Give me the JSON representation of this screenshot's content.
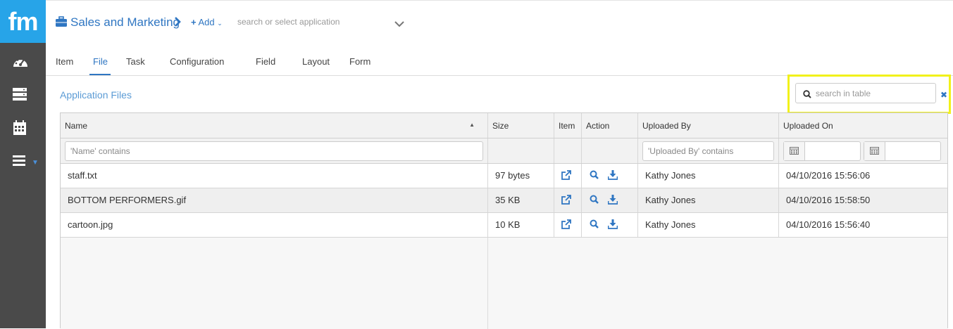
{
  "brand": {
    "logo_text": "fm",
    "color": "#27a4e8"
  },
  "sidebar": {
    "items": [
      {
        "icon": "dashboard-icon"
      },
      {
        "icon": "server-icon"
      },
      {
        "icon": "calendar-icon"
      },
      {
        "icon": "menu-icon"
      }
    ]
  },
  "topbar": {
    "app_name": "Sales and Marketing",
    "add_label": "Add",
    "app_search_placeholder": "search or select application"
  },
  "tabs": [
    {
      "label": "Item"
    },
    {
      "label": "File",
      "active": true
    },
    {
      "label": "Task"
    },
    {
      "label": "Configuration"
    },
    {
      "label": "Field"
    },
    {
      "label": "Layout"
    },
    {
      "label": "Form"
    }
  ],
  "panel": {
    "title": "Application Files",
    "search_placeholder": "search in table"
  },
  "table": {
    "columns": [
      "Name",
      "Size",
      "Item",
      "Action",
      "Uploaded By",
      "Uploaded On"
    ],
    "filters": {
      "name_placeholder": "'Name' contains",
      "uploaded_by_placeholder": "'Uploaded By' contains"
    },
    "rows": [
      {
        "name": "staff.txt",
        "size": "97 bytes",
        "uploaded_by": "Kathy Jones",
        "uploaded_on": "04/10/2016 15:56:06"
      },
      {
        "name": "BOTTOM PERFORMERS.gif",
        "size": "35 KB",
        "uploaded_by": "Kathy Jones",
        "uploaded_on": "04/10/2016 15:58:50"
      },
      {
        "name": "cartoon.jpg",
        "size": "10 KB",
        "uploaded_by": "Kathy Jones",
        "uploaded_on": "04/10/2016 15:56:40"
      }
    ]
  },
  "colors": {
    "accent": "#2f76c2",
    "sidebar": "#4a4a4a",
    "highlight": "#f1f11a"
  }
}
